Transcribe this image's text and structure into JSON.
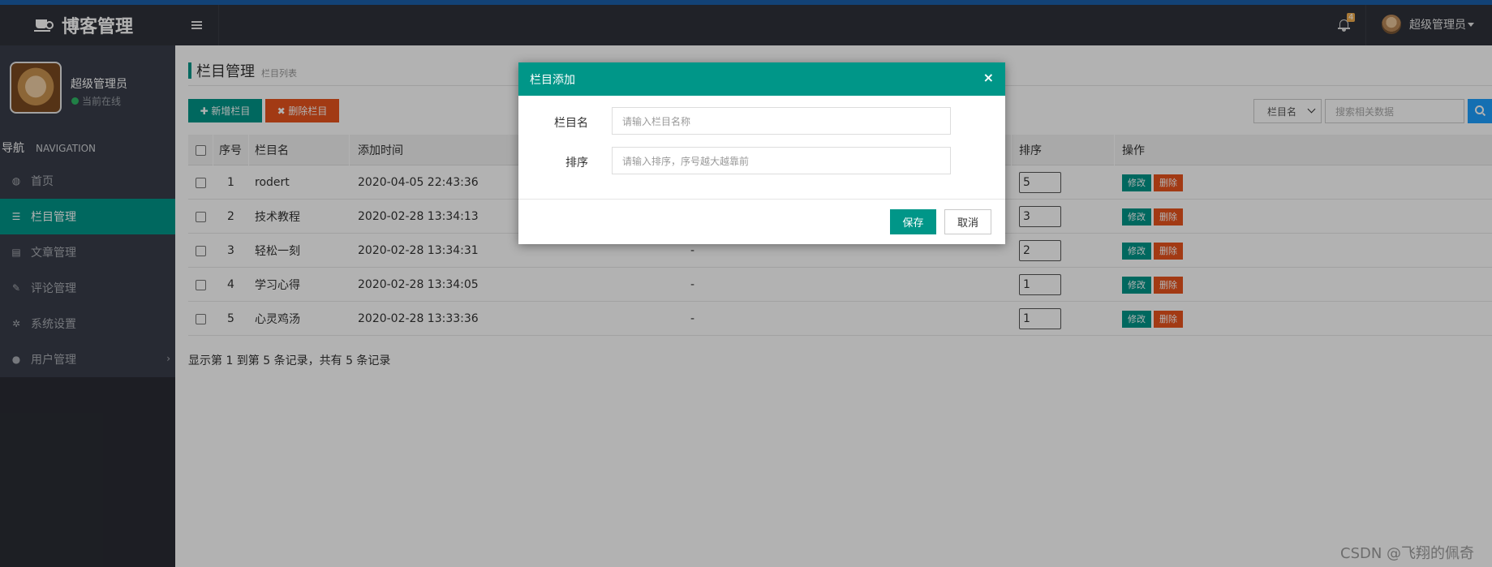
{
  "header": {
    "brand": "博客管理",
    "notification_count": "4",
    "user_name": "超级管理员"
  },
  "sidebar": {
    "profile_name": "超级管理员",
    "profile_status": "当前在线",
    "nav_title": "导航",
    "nav_subtitle": "NAVIGATION",
    "items": [
      {
        "label": "首页",
        "icon": "dashboard-icon"
      },
      {
        "label": "栏目管理",
        "icon": "list-icon",
        "active": true
      },
      {
        "label": "文章管理",
        "icon": "file-icon"
      },
      {
        "label": "评论管理",
        "icon": "edit-icon"
      },
      {
        "label": "系统设置",
        "icon": "gear-icon"
      },
      {
        "label": "用户管理",
        "icon": "user-icon"
      }
    ]
  },
  "page": {
    "title": "栏目管理",
    "subtitle": "栏目列表",
    "add_button": "✚ 新增栏目",
    "delete_button": "✖ 删除栏目",
    "filter_select": "栏目名",
    "search_placeholder": "搜索相关数据"
  },
  "table": {
    "columns": [
      "序号",
      "栏目名",
      "添加时间",
      "排序",
      "操作"
    ],
    "rows": [
      {
        "id": "1",
        "name": "rodert",
        "time": "2020-04-05 22:43:36",
        "desc": "",
        "sort": "5"
      },
      {
        "id": "2",
        "name": "技术教程",
        "time": "2020-02-28 13:34:13",
        "desc": "",
        "sort": "3"
      },
      {
        "id": "3",
        "name": "轻松一刻",
        "time": "2020-02-28 13:34:31",
        "desc": "-",
        "sort": "2"
      },
      {
        "id": "4",
        "name": "学习心得",
        "time": "2020-02-28 13:34:05",
        "desc": "-",
        "sort": "1"
      },
      {
        "id": "5",
        "name": "心灵鸡汤",
        "time": "2020-02-28 13:33:36",
        "desc": "-",
        "sort": "1"
      }
    ],
    "edit_label": "修改",
    "delete_label": "删除",
    "summary": "显示第 1 到第 5 条记录，共有 5 条记录"
  },
  "modal": {
    "title": "栏目添加",
    "close": "×",
    "name_label": "栏目名",
    "name_placeholder": "请输入栏目名称",
    "sort_label": "排序",
    "sort_placeholder": "请输入排序，序号越大越靠前",
    "save": "保存",
    "cancel": "取消"
  },
  "watermark": "CSDN @飞翔的佩奇",
  "colors": {
    "primary": "#009688",
    "danger": "#e8541e",
    "topbar": "#2f323a",
    "sidebar": "#393d49"
  }
}
